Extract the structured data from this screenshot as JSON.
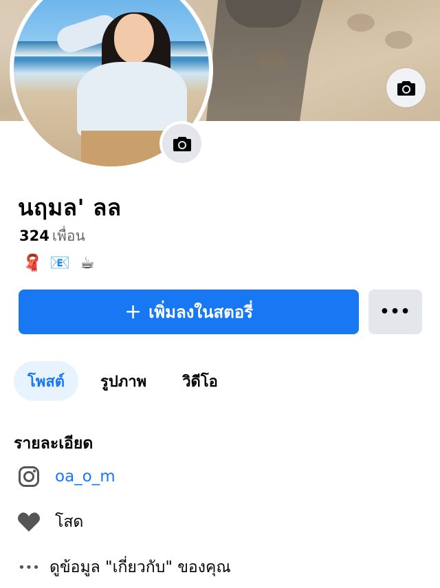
{
  "profile": {
    "name": "นฤมล' ลล",
    "friends_count": "324",
    "friends_label": "เพื่อน",
    "emojis": [
      "🧣",
      "📧",
      "☕"
    ]
  },
  "actions": {
    "add_story_label": "เพิ่มลงในสตอรี่",
    "add_story_icon": "+",
    "more_label": "•••"
  },
  "tabs": [
    {
      "label": "โพสต์",
      "active": true
    },
    {
      "label": "รูปภาพ",
      "active": false
    },
    {
      "label": "วิดีโอ",
      "active": false
    }
  ],
  "details": {
    "title": "รายละเอียด",
    "instagram": "oa_o_m",
    "relationship": "โสด",
    "about_icon": "•••",
    "about_link": "ดูข้อมูล \"เกี่ยวกับ\" ของคุณ"
  },
  "colors": {
    "accent": "#1877f2",
    "active_tab_bg": "#e7f3ff",
    "button_gray": "#e4e6eb",
    "secondary_text": "#65676b"
  }
}
